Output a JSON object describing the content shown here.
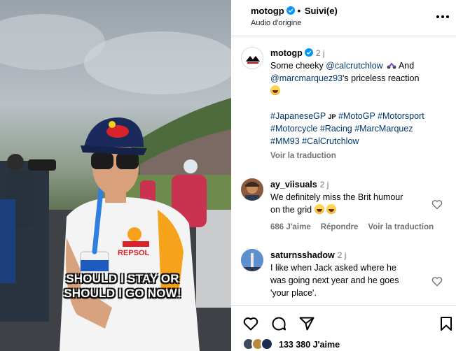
{
  "media": {
    "caption": "SHOULD I STAY OR\nSHOULD I GO NOW!",
    "shirt_text": "REPSOL",
    "colors": {
      "cap": "#1b2a5c",
      "shirt": "#f4f4f4",
      "straw": "#2f7fe0"
    }
  },
  "header": {
    "username": "motogp",
    "dot": "•",
    "follow_label": "Suivi(e)",
    "audio_label": "Audio d'origine",
    "more_icon": "more-horizontal-icon"
  },
  "post": {
    "username": "motogp",
    "time": "2 j",
    "line1": "Some cheeky ",
    "mention1": "@calcrutchlow",
    "line1b": " And",
    "mention2": "@marcmarquez93",
    "line2b": "'s priceless reaction",
    "hashtags_l1a": "#JapaneseGP",
    "jp_flag": "JP",
    "hashtags_l1b": "#MotoGP #Motorsport",
    "hashtags_l2": "#Motorcycle #Racing #MarcMarquez",
    "hashtags_l3": "#MM93 #CalCrutchlow",
    "translate": "Voir la traduction"
  },
  "comments": [
    {
      "username": "ay_viisuals",
      "time": "2 j",
      "text_l1": "We definitely miss the Brit humour",
      "text_l2": "on the grid",
      "likes": "686 J'aime",
      "reply": "Répondre",
      "translate": "Voir la traduction"
    },
    {
      "username": "saturnsshadow",
      "time": "2 j",
      "text_l1": "I like when Jack asked where he",
      "text_l2": "was going next year and he goes",
      "text_l3": "'your place'."
    }
  ],
  "footer": {
    "likes_count": "133 380 J'aime"
  }
}
